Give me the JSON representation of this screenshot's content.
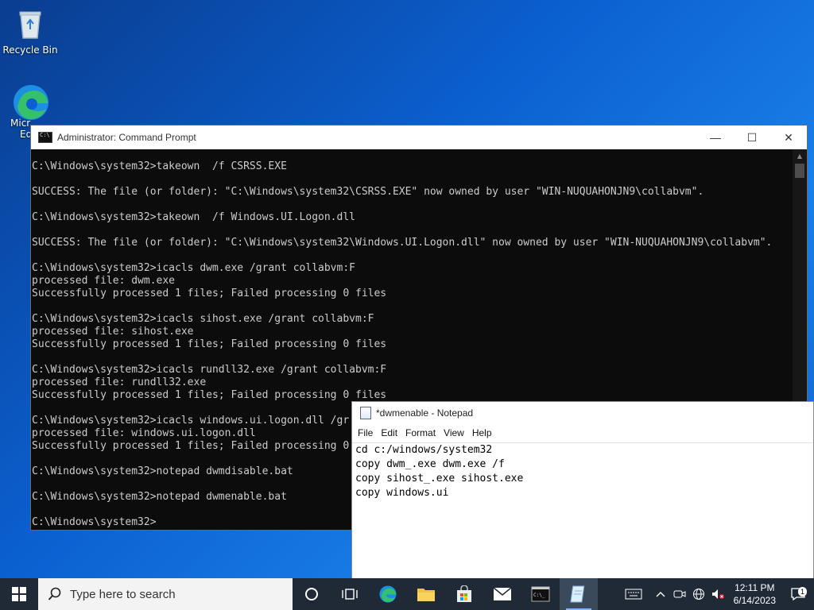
{
  "desktop": {
    "recycle_bin_label": "Recycle Bin",
    "edge_label_line1": "Micr",
    "edge_label_line2": "Ed"
  },
  "cmd": {
    "title": "Administrator: Command Prompt",
    "lines": [
      "C:\\Windows\\system32>takeown  /f CSRSS.EXE",
      "",
      "SUCCESS: The file (or folder): \"C:\\Windows\\system32\\CSRSS.EXE\" now owned by user \"WIN-NUQUAHONJN9\\collabvm\".",
      "",
      "C:\\Windows\\system32>takeown  /f Windows.UI.Logon.dll",
      "",
      "SUCCESS: The file (or folder): \"C:\\Windows\\system32\\Windows.UI.Logon.dll\" now owned by user \"WIN-NUQUAHONJN9\\collabvm\".",
      "",
      "C:\\Windows\\system32>icacls dwm.exe /grant collabvm:F",
      "processed file: dwm.exe",
      "Successfully processed 1 files; Failed processing 0 files",
      "",
      "C:\\Windows\\system32>icacls sihost.exe /grant collabvm:F",
      "processed file: sihost.exe",
      "Successfully processed 1 files; Failed processing 0 files",
      "",
      "C:\\Windows\\system32>icacls rundll32.exe /grant collabvm:F",
      "processed file: rundll32.exe",
      "Successfully processed 1 files; Failed processing 0 files",
      "",
      "C:\\Windows\\system32>icacls windows.ui.logon.dll /gr",
      "processed file: windows.ui.logon.dll",
      "Successfully processed 1 files; Failed processing 0",
      "",
      "C:\\Windows\\system32>notepad dwmdisable.bat",
      "",
      "C:\\Windows\\system32>notepad dwmenable.bat",
      "",
      "C:\\Windows\\system32>"
    ]
  },
  "notepad": {
    "title": "*dwmenable - Notepad",
    "menu": [
      "File",
      "Edit",
      "Format",
      "View",
      "Help"
    ],
    "lines": [
      "cd c:/windows/system32",
      "copy dwm_.exe dwm.exe /f",
      "copy sihost_.exe sihost.exe",
      "copy windows.ui"
    ]
  },
  "window_controls": {
    "minimize": "—",
    "maximize": "☐",
    "close": "✕"
  },
  "taskbar": {
    "search_placeholder": "Type here to search",
    "time": "12:11 PM",
    "date": "6/14/2023",
    "notification_count": "1"
  }
}
